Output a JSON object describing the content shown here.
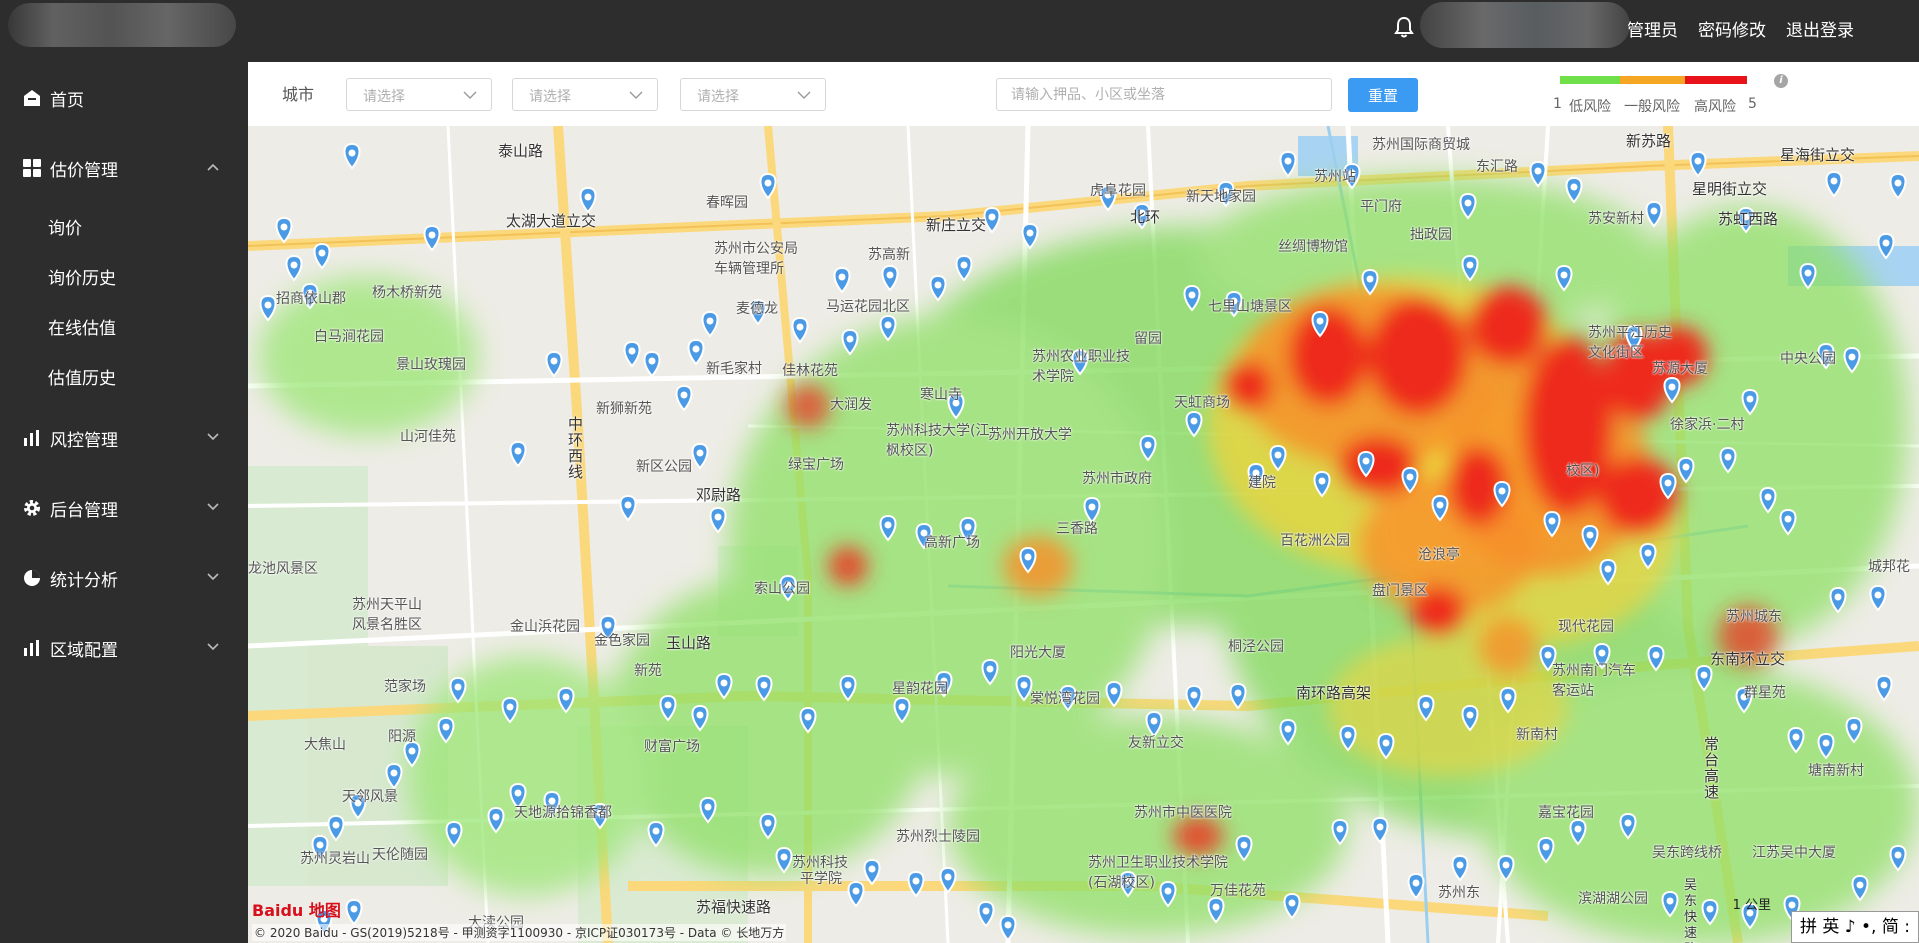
{
  "header": {
    "admin_label": "管理员",
    "change_password": "密码修改",
    "logout": "退出登录",
    "bell_icon": "bell-icon"
  },
  "sidebar": {
    "items": [
      {
        "label": "首页",
        "icon": "home-icon"
      },
      {
        "label": "估价管理",
        "icon": "grid-icon",
        "expanded": true,
        "children": [
          "询价",
          "询价历史",
          "在线估值",
          "估值历史"
        ]
      },
      {
        "label": "风控管理",
        "icon": "bar-chart-icon"
      },
      {
        "label": "后台管理",
        "icon": "gear-icon"
      },
      {
        "label": "统计分析",
        "icon": "pie-chart-icon"
      },
      {
        "label": "区域配置",
        "icon": "bar-chart-icon"
      }
    ]
  },
  "filters": {
    "city_label": "城市",
    "select_placeholder": "请选择",
    "search_placeholder": "请输入押品、小区或坐落",
    "reset": "重置"
  },
  "risk_legend": {
    "min": "1",
    "max": "5",
    "low": "低风险",
    "normal": "一般风险",
    "high": "高风险",
    "colors": [
      "#6fe04a",
      "#f5a623",
      "#e8121b"
    ]
  },
  "map": {
    "places": [
      {
        "label": "泰山路"
      },
      {
        "label": "太湖大道立交"
      },
      {
        "label": "春晖园"
      },
      {
        "label": "苏州市公安局车辆管理所"
      },
      {
        "label": "新庄立交"
      },
      {
        "label": "虎阜花园"
      },
      {
        "label": "新天地家园"
      },
      {
        "label": "苏州站"
      },
      {
        "label": "苏州国际商贸城"
      },
      {
        "label": "东汇路"
      },
      {
        "label": "平门府"
      },
      {
        "label": "丝绸博物馆"
      },
      {
        "label": "拙政园"
      },
      {
        "label": "新苏路"
      },
      {
        "label": "星海街立交"
      },
      {
        "label": "星明街立交"
      },
      {
        "label": "苏安新村"
      },
      {
        "label": "苏虹西路"
      },
      {
        "label": "招商依山郡"
      },
      {
        "label": "杨木桥新苑"
      },
      {
        "label": "白马涧花园"
      },
      {
        "label": "景山玫瑰园"
      },
      {
        "label": "马运花园北区"
      },
      {
        "label": "麦德龙"
      },
      {
        "label": "苏高新"
      },
      {
        "label": "北环"
      },
      {
        "label": "七里山塘景区"
      },
      {
        "label": "留园"
      },
      {
        "label": "苏州平江历史文化街区"
      },
      {
        "label": "中央公园"
      },
      {
        "label": "新毛家村"
      },
      {
        "label": "佳林花苑"
      },
      {
        "label": "苏州农业职业技术学院"
      },
      {
        "label": "苏源大厦"
      },
      {
        "label": "寒山寺"
      },
      {
        "label": "天虹商场"
      },
      {
        "label": "新狮新苑"
      },
      {
        "label": "大润发"
      },
      {
        "label": "苏州科技大学(江枫校区)"
      },
      {
        "label": "苏州开放大学"
      },
      {
        "label": "徐家浜·二村"
      },
      {
        "label": "山河佳苑"
      },
      {
        "label": "中环西线"
      },
      {
        "label": "新区公园"
      },
      {
        "label": "绿宝广场"
      },
      {
        "label": "苏州市政府"
      },
      {
        "label": "建院"
      },
      {
        "label": "校区)"
      },
      {
        "label": "邓尉路"
      },
      {
        "label": "高新广场"
      },
      {
        "label": "三香路"
      },
      {
        "label": "百花洲公园"
      },
      {
        "label": "沧浪亭"
      },
      {
        "label": "龙池风景区"
      },
      {
        "label": "索山公园"
      },
      {
        "label": "盘门景区"
      },
      {
        "label": "城邦花"
      },
      {
        "label": "苏州天平山风景名胜区"
      },
      {
        "label": "金山浜花园"
      },
      {
        "label": "金色家园"
      },
      {
        "label": "玉山路"
      },
      {
        "label": "桐泾公园"
      },
      {
        "label": "现代花园"
      },
      {
        "label": "苏州城东"
      },
      {
        "label": "新苑"
      },
      {
        "label": "阳光大厦"
      },
      {
        "label": "东南环立交"
      },
      {
        "label": "范家场"
      },
      {
        "label": "星韵花园"
      },
      {
        "label": "棠悦湾花园"
      },
      {
        "label": "苏州南门汽车客运站"
      },
      {
        "label": "群星苑"
      },
      {
        "label": "南环路高架"
      },
      {
        "label": "大焦山"
      },
      {
        "label": "阳源"
      },
      {
        "label": "财富广场"
      },
      {
        "label": "友新立交"
      },
      {
        "label": "新南村"
      },
      {
        "label": "天邻风景"
      },
      {
        "label": "天地源拾锦香都"
      },
      {
        "label": "苏州市中医医院"
      },
      {
        "label": "嘉宝花园"
      },
      {
        "label": "苏州烈士陵园"
      },
      {
        "label": "苏州灵岩山"
      },
      {
        "label": "天伦随园"
      },
      {
        "label": "苏州科技"
      },
      {
        "label": "苏州卫生职业技术学院(石湖校区)"
      },
      {
        "label": "吴东跨线桥"
      },
      {
        "label": "江苏吴中大厦"
      },
      {
        "label": "常台高速"
      },
      {
        "label": "塘南新村"
      },
      {
        "label": "苏福快速路"
      },
      {
        "label": "万佳花苑"
      },
      {
        "label": "平学院"
      },
      {
        "label": "苏州东"
      },
      {
        "label": "滨湖湖公园"
      },
      {
        "label": "吴东快速路"
      },
      {
        "label": "大渎公园"
      }
    ],
    "copyright": "© 2020 Baidu - GS(2019)5218号 - 甲测资字1100930 - 京ICP证030173号 - Data © 长地万方",
    "logo_text": "Baidu 地图",
    "scale_label": "1 公里",
    "ime_text": "拼 英 ♪ •, 简 :"
  }
}
